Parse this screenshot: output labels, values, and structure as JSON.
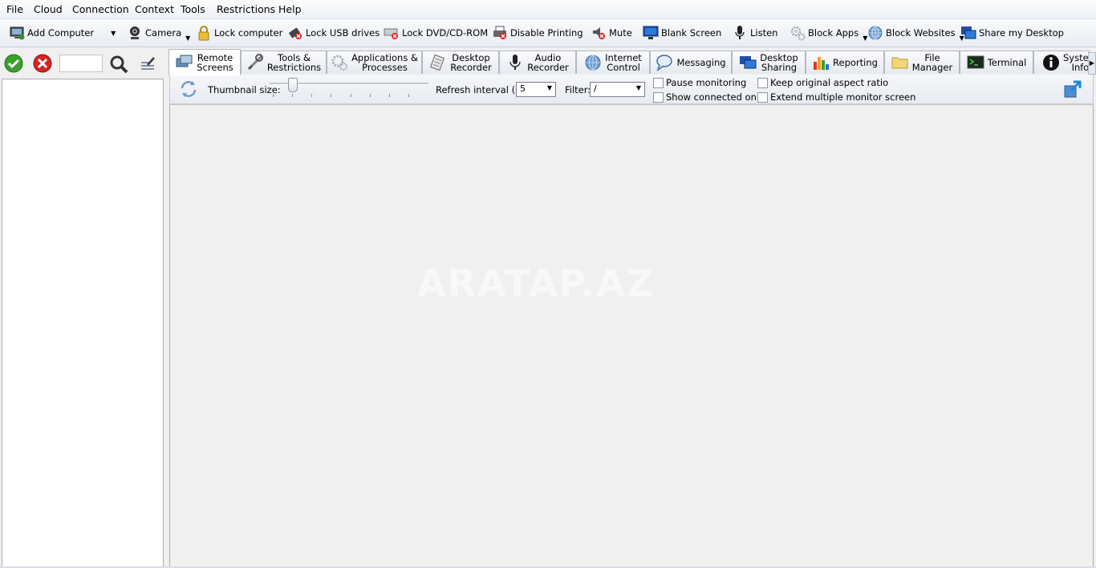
{
  "menu": [
    "File",
    "Cloud",
    "Connection",
    "Context",
    "Tools",
    "Restrictions",
    "Help"
  ],
  "toolbar": {
    "add_computer": "Add Computer",
    "camera": "Camera",
    "lock_computer": "Lock computer",
    "lock_usb": "Lock USB drives",
    "lock_dvd": "Lock DVD/CD-ROM",
    "disable_printing": "Disable Printing",
    "mute": "Mute",
    "blank_screen": "Blank Screen",
    "listen": "Listen",
    "block_apps": "Block Apps",
    "block_websites": "Block Websites",
    "share_desktop": "Share my Desktop"
  },
  "tabs": [
    {
      "l1": "Remote",
      "l2": "Screens"
    },
    {
      "l1": "Tools &",
      "l2": "Restrictions"
    },
    {
      "l1": "Applications &",
      "l2": "Processes"
    },
    {
      "l1": "Desktop",
      "l2": "Recorder"
    },
    {
      "l1": "Audio",
      "l2": "Recorder"
    },
    {
      "l1": "Internet",
      "l2": "Control"
    },
    {
      "l1": "Messaging",
      "l2": ""
    },
    {
      "l1": "Desktop",
      "l2": "Sharing"
    },
    {
      "l1": "Reporting",
      "l2": ""
    },
    {
      "l1": "File",
      "l2": "Manager"
    },
    {
      "l1": "Terminal",
      "l2": ""
    },
    {
      "l1": "System",
      "l2": "Info"
    }
  ],
  "options": {
    "thumbnail_label": "Thumbnail size:",
    "refresh_label": "Refresh interval (s):",
    "refresh_value": "5",
    "filter_label": "Filter:",
    "filter_value": "/",
    "pause_monitoring": "Pause monitoring",
    "show_connected": "Show connected only",
    "keep_aspect": "Keep original aspect ratio",
    "extend_monitor": "Extend multiple monitor screen"
  },
  "watermark": "ARATAP.AZ"
}
